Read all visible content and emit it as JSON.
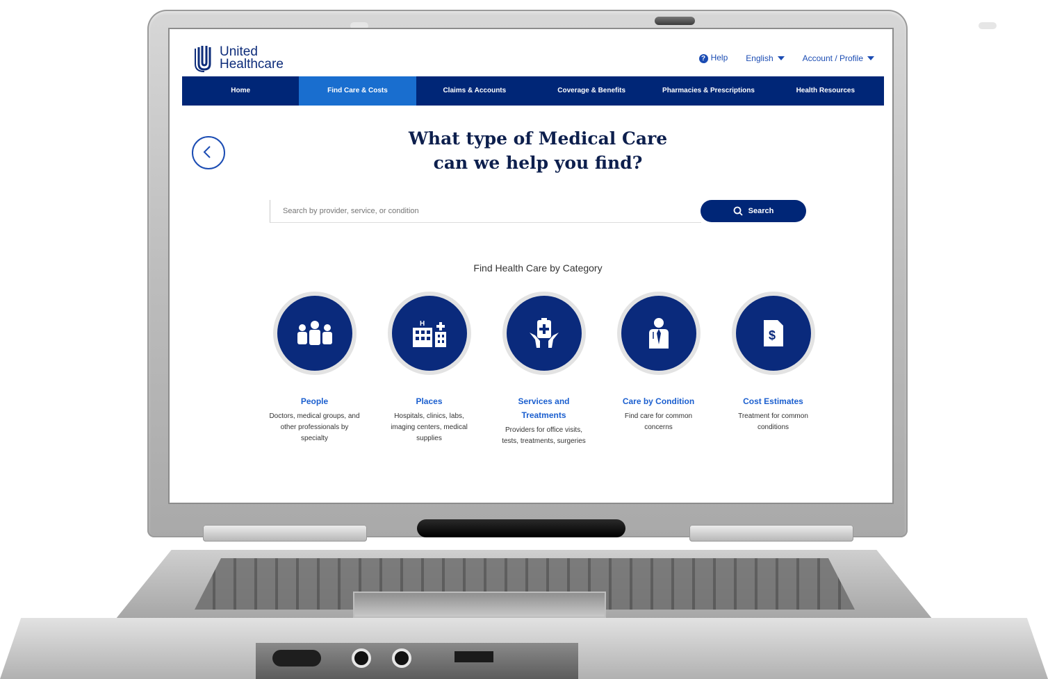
{
  "brand": {
    "line1": "United",
    "line2": "Healthcare"
  },
  "utility": {
    "help": "Help",
    "language": "English",
    "account": "Account / Profile"
  },
  "nav": [
    {
      "label": "Home"
    },
    {
      "label": "Find Care & Costs"
    },
    {
      "label": "Claims & Accounts"
    },
    {
      "label": "Coverage & Benefits"
    },
    {
      "label": "Pharmacies & Prescriptions"
    },
    {
      "label": "Health Resources"
    }
  ],
  "headline": {
    "line1": "What type of Medical Care",
    "line2": "can we help you find?"
  },
  "search": {
    "placeholder": "Search by provider, service, or condition",
    "button": "Search"
  },
  "section_title": "Find Health Care by Category",
  "categories": [
    {
      "title": "People",
      "desc": "Doctors, medical groups, and other professionals by specialty",
      "icon": "people-icon"
    },
    {
      "title": "Places",
      "desc": "Hospitals, clinics, labs, imaging centers, medical supplies",
      "icon": "buildings-icon"
    },
    {
      "title": "Services and Treatments",
      "desc": "Providers for office visits, tests, treatments, surgeries",
      "icon": "clipboard-hands-icon"
    },
    {
      "title": "Care by Condition",
      "desc": "Find care for common concerns",
      "icon": "doctor-icon"
    },
    {
      "title": "Cost Estimates",
      "desc": "Treatment for common conditions",
      "icon": "dollar-document-icon"
    }
  ],
  "colors": {
    "navy": "#002677",
    "active_tab": "#196ecf",
    "link": "#1b5fcf"
  }
}
